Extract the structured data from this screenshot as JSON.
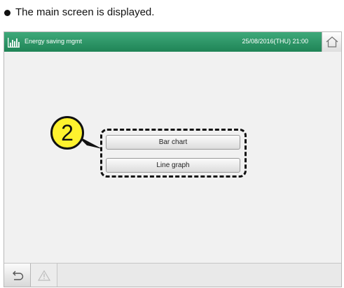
{
  "caption": "The main screen is displayed.",
  "header": {
    "app_title": "Energy saving mgmt",
    "datetime": "25/08/2016(THU) 21:00",
    "accent_color": "#2a9566",
    "app_icon": "bar-chart-icon",
    "home_icon": "home-icon"
  },
  "menu": {
    "bar_chart_label": "Bar chart",
    "line_graph_label": "Line graph"
  },
  "annotation": {
    "step_number": "2",
    "marker_color": "#fff22e"
  },
  "footer": {
    "back_icon": "return-arrow-icon",
    "warning_icon": "warning-icon"
  }
}
